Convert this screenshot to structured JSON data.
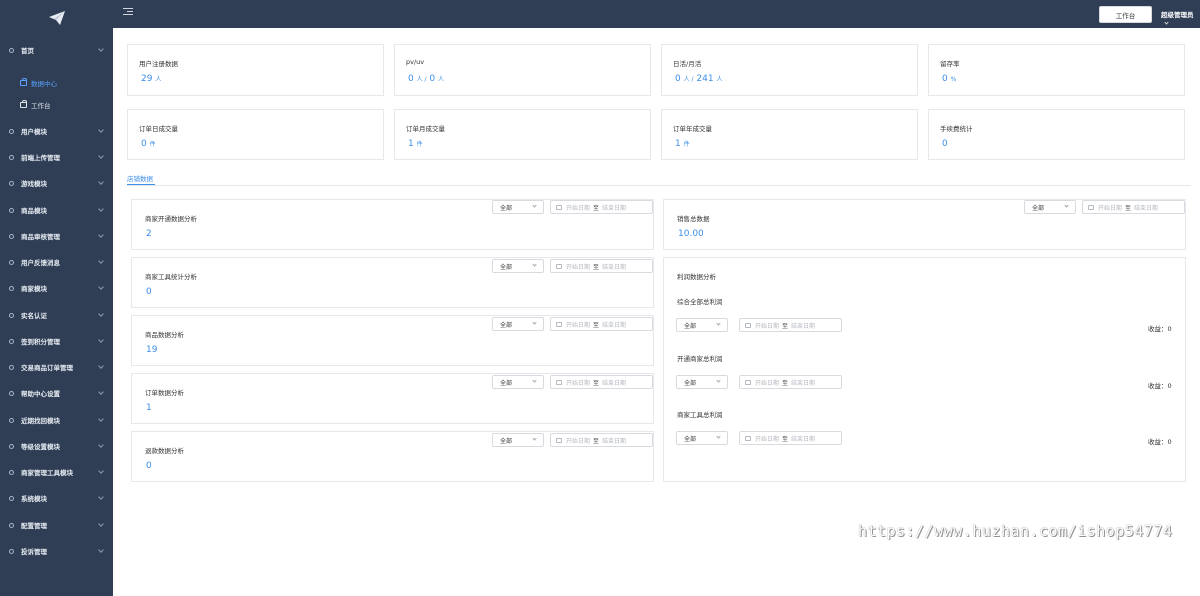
{
  "sidebar": {
    "items": [
      {
        "label": "首页"
      },
      {
        "label": "用户模块"
      },
      {
        "label": "前端上传管理"
      },
      {
        "label": "游戏模块"
      },
      {
        "label": "商品模块"
      },
      {
        "label": "商品审核管理"
      },
      {
        "label": "用户反馈消息"
      },
      {
        "label": "商家模块"
      },
      {
        "label": "实名认证"
      },
      {
        "label": "签到积分管理"
      },
      {
        "label": "交易商品订单管理"
      },
      {
        "label": "帮助中心设置"
      },
      {
        "label": "近期找回模块"
      },
      {
        "label": "等级设置模块"
      },
      {
        "label": "商家管理工具模块"
      },
      {
        "label": "系统模块"
      },
      {
        "label": "配置管理"
      },
      {
        "label": "投诉管理"
      }
    ],
    "sub_items": [
      {
        "label": "数据中心",
        "active": true
      },
      {
        "label": "工作台",
        "active": false
      }
    ]
  },
  "header": {
    "workbench_button": "工作台",
    "admin_name": "超级管理员"
  },
  "stats": [
    {
      "title": "用户注册数据",
      "v1": "29",
      "u1": "人"
    },
    {
      "title": "pv/uv",
      "v1": "0",
      "u1": "人 /",
      "v2": "0",
      "u2": "人"
    },
    {
      "title": "日活/月活",
      "v1": "0",
      "u1": "人 /",
      "v2": "241",
      "u2": "人"
    },
    {
      "title": "留存率",
      "v1": "0",
      "u1": "%"
    },
    {
      "title": "订单日成交量",
      "v1": "0",
      "u1": "件"
    },
    {
      "title": "订单月成交量",
      "v1": "1",
      "u1": "件"
    },
    {
      "title": "订单年成交量",
      "v1": "1",
      "u1": "件"
    },
    {
      "title": "手续费统计",
      "v1": "0",
      "u1": ""
    }
  ],
  "tab": {
    "label": "店铺数据"
  },
  "filter": {
    "select_value": "全部",
    "start_placeholder": "开始日期",
    "separator": "至",
    "end_placeholder": "结束日期"
  },
  "left_panels": [
    {
      "title": "商家开通数据分析",
      "value": "2"
    },
    {
      "title": "商家工具统计分析",
      "value": "0"
    },
    {
      "title": "商品数据分析",
      "value": "19"
    },
    {
      "title": "订单数据分析",
      "value": "1"
    },
    {
      "title": "退款数据分析",
      "value": "0"
    }
  ],
  "sales_panel": {
    "title": "销售总数据",
    "value": "10.00"
  },
  "profit_panel": {
    "title": "利润数据分析",
    "rows": [
      {
        "title": "综合全部总利润",
        "income": "收益：0"
      },
      {
        "title": "开通商家总利润",
        "income": "收益：0"
      },
      {
        "title": "商家工具总利润",
        "income": "收益：0"
      }
    ]
  },
  "watermark": "https://www.huzhan.com/ishop54774"
}
